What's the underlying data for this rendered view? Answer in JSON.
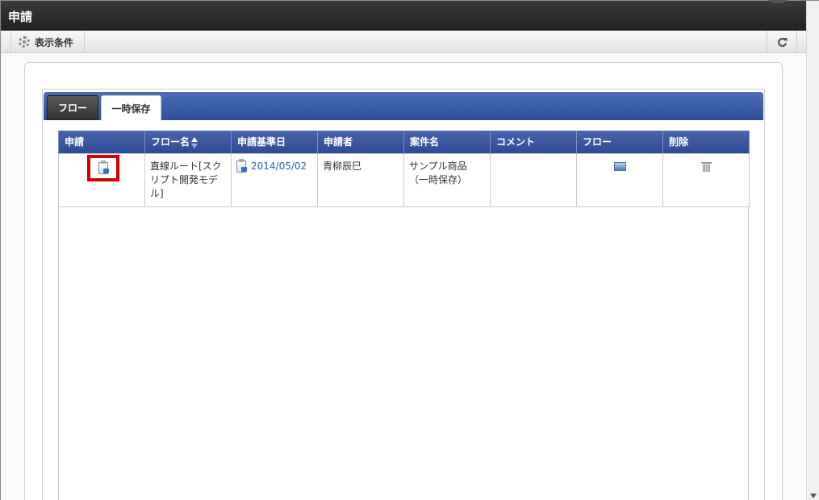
{
  "window": {
    "title": "申請"
  },
  "toolbar": {
    "conditions_label": "表示条件"
  },
  "tabs": [
    {
      "label": "フロー",
      "active": false
    },
    {
      "label": "一時保存",
      "active": true
    }
  ],
  "table": {
    "headers": [
      "申請",
      "フロー名",
      "申請基準日",
      "申請者",
      "案件名",
      "コメント",
      "フロー",
      "削除"
    ],
    "rows": [
      {
        "flow_name": "直線ルート[スクリプト開発モデル]",
        "base_date": "2014/05/02",
        "applicant": "青柳辰巳",
        "subject": "サンプル商品（一時保存）",
        "comment": ""
      }
    ]
  },
  "colors": {
    "header_blue": "#2d4b95",
    "highlight_red": "#d40000",
    "link_blue": "#2a62b8"
  }
}
